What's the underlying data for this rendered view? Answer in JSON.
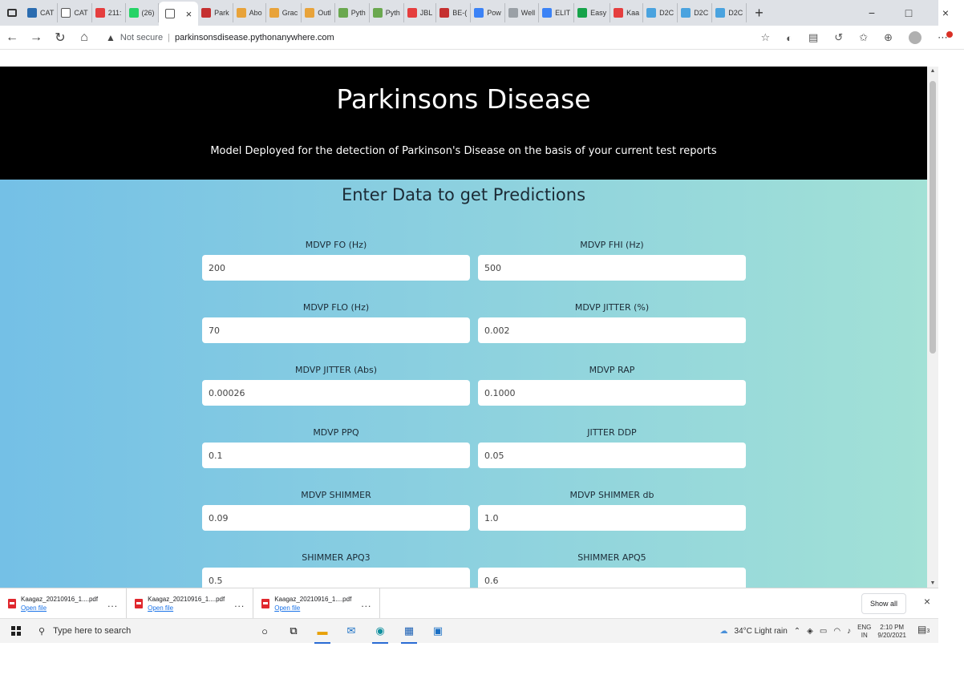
{
  "browser": {
    "tabs": [
      {
        "label": "CAT",
        "color": "#2b6cb0"
      },
      {
        "label": "CAT",
        "color": "#ffffff"
      },
      {
        "label": "211:",
        "color": "#e53e3e"
      },
      {
        "label": "(26)",
        "color": "#25d366"
      },
      {
        "label": "",
        "color": "#ffffff",
        "active": true
      },
      {
        "label": "Park",
        "color": "#c53030"
      },
      {
        "label": "Abo",
        "color": "#e8a33a"
      },
      {
        "label": "Grac",
        "color": "#e8a33a"
      },
      {
        "label": "Outl",
        "color": "#e8a33a"
      },
      {
        "label": "Pyth",
        "color": "#6aa84f"
      },
      {
        "label": "Pyth",
        "color": "#6aa84f"
      },
      {
        "label": "JBL",
        "color": "#e53e3e"
      },
      {
        "label": "BE-(",
        "color": "#c53030"
      },
      {
        "label": "Pow",
        "color": "#3b82f6"
      },
      {
        "label": "Well",
        "color": "#9aa0a6"
      },
      {
        "label": "ELIT",
        "color": "#3b82f6"
      },
      {
        "label": "Easy",
        "color": "#16a34a"
      },
      {
        "label": "Kaa",
        "color": "#e53e3e"
      },
      {
        "label": "D2C",
        "color": "#4aa3df"
      },
      {
        "label": "D2C",
        "color": "#4aa3df"
      },
      {
        "label": "D2C",
        "color": "#4aa3df"
      }
    ],
    "active_tab_close": "×",
    "new_tab": "+",
    "window_controls": {
      "minimize": "−",
      "maximize": "□",
      "close": "×"
    },
    "nav": {
      "back": "←",
      "forward": "→",
      "refresh": "↻",
      "home": "⌂"
    },
    "security_warning": "Not secure",
    "url": "parkinsonsdisease.pythonanywhere.com"
  },
  "page": {
    "title": "Parkinsons Disease",
    "subtitle": "Model Deployed for the detection of Parkinson's Disease on the basis of your current test reports",
    "form_title": "Enter Data to get Predictions",
    "fields": [
      {
        "label": "MDVP FO (Hz)",
        "value": "200"
      },
      {
        "label": "MDVP FHI (Hz)",
        "value": "500"
      },
      {
        "label": "MDVP FLO (Hz)",
        "value": "70"
      },
      {
        "label": "MDVP JITTER (%)",
        "value": "0.002"
      },
      {
        "label": "MDVP JITTER (Abs)",
        "value": "0.00026"
      },
      {
        "label": "MDVP RAP",
        "value": "0.1000"
      },
      {
        "label": "MDVP PPQ",
        "value": "0.1"
      },
      {
        "label": "JITTER DDP",
        "value": "0.05"
      },
      {
        "label": "MDVP SHIMMER",
        "value": "0.09"
      },
      {
        "label": "MDVP SHIMMER db",
        "value": "1.0"
      },
      {
        "label": "SHIMMER APQ3",
        "value": "0.5"
      },
      {
        "label": "SHIMMER APQ5",
        "value": "0.6"
      }
    ]
  },
  "downloads": {
    "items": [
      {
        "name": "Kaagaz_20210916_1....pdf",
        "action": "Open file"
      },
      {
        "name": "Kaagaz_20210916_1....pdf",
        "action": "Open file"
      },
      {
        "name": "Kaagaz_20210916_1....pdf",
        "action": "Open file"
      }
    ],
    "more": "...",
    "show_all": "Show all",
    "close": "×"
  },
  "taskbar": {
    "search_placeholder": "Type here to search",
    "weather": "34°C  Light rain",
    "language": "ENG",
    "region": "IN",
    "time": "2:10 PM",
    "date": "9/20/2021",
    "notification_count": "3"
  }
}
